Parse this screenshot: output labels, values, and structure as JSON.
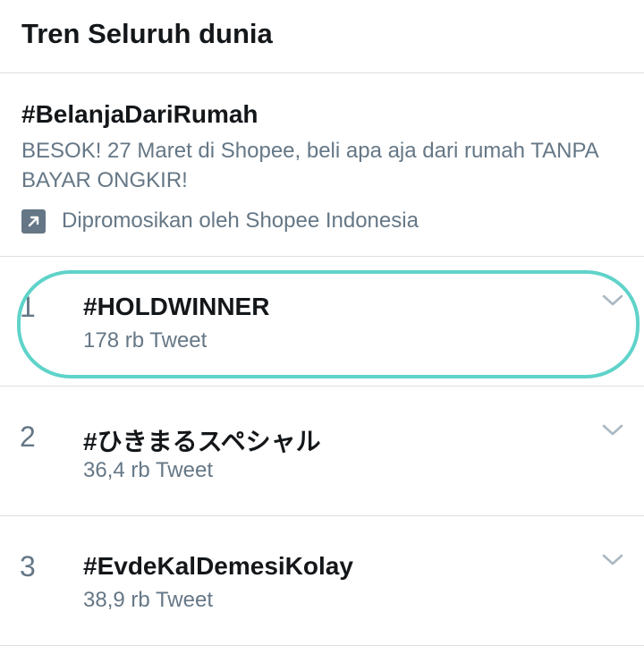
{
  "header": {
    "title": "Tren Seluruh dunia"
  },
  "promoted": {
    "hashtag": "#BelanjaDariRumah",
    "description": "BESOK! 27 Maret di Shopee, beli apa aja dari rumah TANPA BAYAR ONGKIR!",
    "promoted_by": "Dipromosikan oleh Shopee Indonesia",
    "icon": "promoted-arrow-icon"
  },
  "trends": [
    {
      "rank": "1",
      "name": "#HOLDWINNER",
      "count": "178 rb Tweet"
    },
    {
      "rank": "2",
      "name": "#ひきまるスペシャル",
      "count": "36,4 rb Tweet"
    },
    {
      "rank": "3",
      "name": "#EvdeKalDemesiKolay",
      "count": "38,9 rb Tweet"
    }
  ],
  "colors": {
    "text_primary": "#14171a",
    "text_secondary": "#657786",
    "divider": "#d9dfe3",
    "highlight_annotation": "#5fd3c9"
  }
}
